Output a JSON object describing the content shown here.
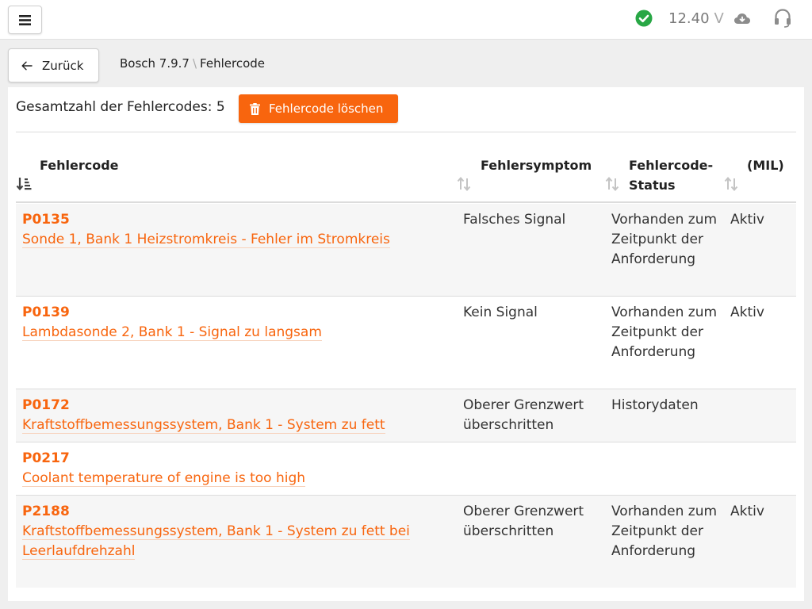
{
  "topbar": {
    "voltage_value": "12.40",
    "voltage_unit": "V",
    "menu_icon": "hamburger-icon",
    "status_icon": "check-circle-icon",
    "cloud_icon": "cloud-download-icon",
    "support_icon": "headset-icon",
    "status_color": "#28a745"
  },
  "nav": {
    "back_label": "Zurück",
    "breadcrumb_parent": "Bosch 7.9.7",
    "breadcrumb_sep": "\\",
    "breadcrumb_current": "Fehlercode"
  },
  "summary": {
    "total_label": "Gesamtzahl der Fehlercodes: 5",
    "delete_label": "Fehlercode löschen"
  },
  "table": {
    "headers": {
      "code": "Fehlercode",
      "symptom": "Fehlersymptom",
      "status_line1": "Fehlercode-",
      "status_line2": "Status",
      "mil": "(MIL)"
    },
    "rows": [
      {
        "code": "P0135",
        "desc": "Sonde 1, Bank 1 Heizstromkreis - Fehler im Stromkreis",
        "symptom": "Falsches Signal",
        "status": "Vorhanden zum Zeitpunkt der Anforderung",
        "mil": "Aktiv"
      },
      {
        "code": "P0139",
        "desc": "Lambdasonde 2, Bank 1 - Signal zu langsam",
        "symptom": "Kein Signal",
        "status": "Vorhanden zum Zeitpunkt der Anforderung",
        "mil": "Aktiv"
      },
      {
        "code": "P0172",
        "desc": "Kraftstoffbemessungssystem, Bank 1 - System zu fett",
        "symptom": "Oberer Grenzwert überschritten",
        "status": "Historydaten",
        "mil": ""
      },
      {
        "code": "P0217",
        "desc": "Coolant temperature of engine is too high",
        "symptom": "",
        "status": "",
        "mil": ""
      },
      {
        "code": "P2188",
        "desc": "Kraftstoffbemessungssystem, Bank 1 - System zu fett bei Leerlaufdrehzahl",
        "symptom": "Oberer Grenzwert überschritten",
        "status": "Vorhanden zum Zeitpunkt der Anforderung",
        "mil": "Aktiv"
      }
    ]
  },
  "colors": {
    "accent": "#f8650e",
    "row_alt": "#f6f6f6",
    "background": "#efefef"
  }
}
